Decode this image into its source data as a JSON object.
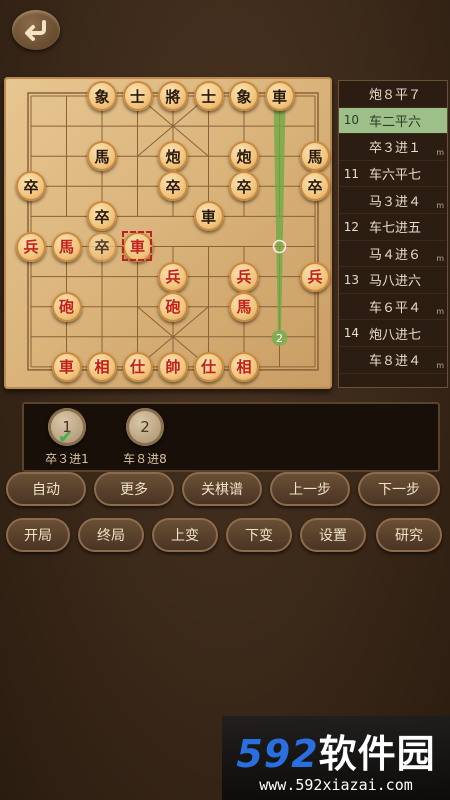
{
  "header": {
    "back_icon": "back-arrow-icon"
  },
  "board": {
    "pieces": [
      {
        "text": "象",
        "color": "black",
        "col": 2,
        "row": 0
      },
      {
        "text": "士",
        "color": "black",
        "col": 3,
        "row": 0
      },
      {
        "text": "將",
        "color": "black",
        "col": 4,
        "row": 0
      },
      {
        "text": "士",
        "color": "black",
        "col": 5,
        "row": 0
      },
      {
        "text": "象",
        "color": "black",
        "col": 6,
        "row": 0
      },
      {
        "text": "車",
        "color": "black",
        "col": 7,
        "row": 0
      },
      {
        "text": "馬",
        "color": "black",
        "col": 2,
        "row": 2
      },
      {
        "text": "炮",
        "color": "black",
        "col": 4,
        "row": 2
      },
      {
        "text": "炮",
        "color": "black",
        "col": 6,
        "row": 2
      },
      {
        "text": "馬",
        "color": "black",
        "col": 8,
        "row": 2
      },
      {
        "text": "卒",
        "color": "black",
        "col": 0,
        "row": 3
      },
      {
        "text": "卒",
        "color": "black",
        "col": 4,
        "row": 3
      },
      {
        "text": "卒",
        "color": "black",
        "col": 6,
        "row": 3
      },
      {
        "text": "卒",
        "color": "black",
        "col": 8,
        "row": 3
      },
      {
        "text": "卒",
        "color": "black",
        "col": 2,
        "row": 4
      },
      {
        "text": "車",
        "color": "black",
        "col": 5,
        "row": 4
      },
      {
        "text": "卒",
        "color": "black",
        "col": 2,
        "row": 5,
        "faded": true
      },
      {
        "text": "兵",
        "color": "red",
        "col": 0,
        "row": 5
      },
      {
        "text": "馬",
        "color": "red",
        "col": 1,
        "row": 5
      },
      {
        "text": "車",
        "color": "red",
        "col": 3,
        "row": 5
      },
      {
        "text": "兵",
        "color": "red",
        "col": 4,
        "row": 6
      },
      {
        "text": "兵",
        "color": "red",
        "col": 6,
        "row": 6
      },
      {
        "text": "兵",
        "color": "red",
        "col": 8,
        "row": 6
      },
      {
        "text": "砲",
        "color": "red",
        "col": 1,
        "row": 7
      },
      {
        "text": "砲",
        "color": "red",
        "col": 4,
        "row": 7
      },
      {
        "text": "馬",
        "color": "red",
        "col": 6,
        "row": 7
      },
      {
        "text": "車",
        "color": "red",
        "col": 1,
        "row": 9
      },
      {
        "text": "相",
        "color": "red",
        "col": 2,
        "row": 9
      },
      {
        "text": "仕",
        "color": "red",
        "col": 3,
        "row": 9
      },
      {
        "text": "帥",
        "color": "red",
        "col": 4,
        "row": 9
      },
      {
        "text": "仕",
        "color": "red",
        "col": 5,
        "row": 9
      },
      {
        "text": "相",
        "color": "red",
        "col": 6,
        "row": 9
      }
    ],
    "arrow_label": "2"
  },
  "moves": [
    {
      "num": "",
      "text": "炮８平７",
      "tag": "",
      "active": false
    },
    {
      "num": "10",
      "text": "车二平六",
      "tag": "",
      "active": true
    },
    {
      "num": "",
      "text": "卒３进１",
      "tag": "m",
      "active": false
    },
    {
      "num": "11",
      "text": "车六平七",
      "tag": "",
      "active": false
    },
    {
      "num": "",
      "text": "马３进４",
      "tag": "m",
      "active": false
    },
    {
      "num": "12",
      "text": "车七进五",
      "tag": "",
      "active": false
    },
    {
      "num": "",
      "text": "马４进６",
      "tag": "m",
      "active": false
    },
    {
      "num": "13",
      "text": "马八进六",
      "tag": "",
      "active": false
    },
    {
      "num": "",
      "text": "车６平４",
      "tag": "m",
      "active": false
    },
    {
      "num": "14",
      "text": "炮八进七",
      "tag": "",
      "active": false
    },
    {
      "num": "",
      "text": "车８进４",
      "tag": "m",
      "active": false
    },
    {
      "num": "",
      "text": "…",
      "tag": "",
      "active": false
    }
  ],
  "variations": [
    {
      "number": "1",
      "label": "卒３进1",
      "checked": true
    },
    {
      "number": "2",
      "label": "车８进8",
      "checked": false
    }
  ],
  "buttons_row1": [
    "自动",
    "更多",
    "关棋谱",
    "上一步",
    "下一步"
  ],
  "buttons_row2": [
    "开局",
    "终局",
    "上变",
    "下变",
    "设置",
    "研究"
  ],
  "watermark": {
    "logo_num": "592",
    "logo_text": "软件园",
    "url": "www.592xiazai.com"
  }
}
